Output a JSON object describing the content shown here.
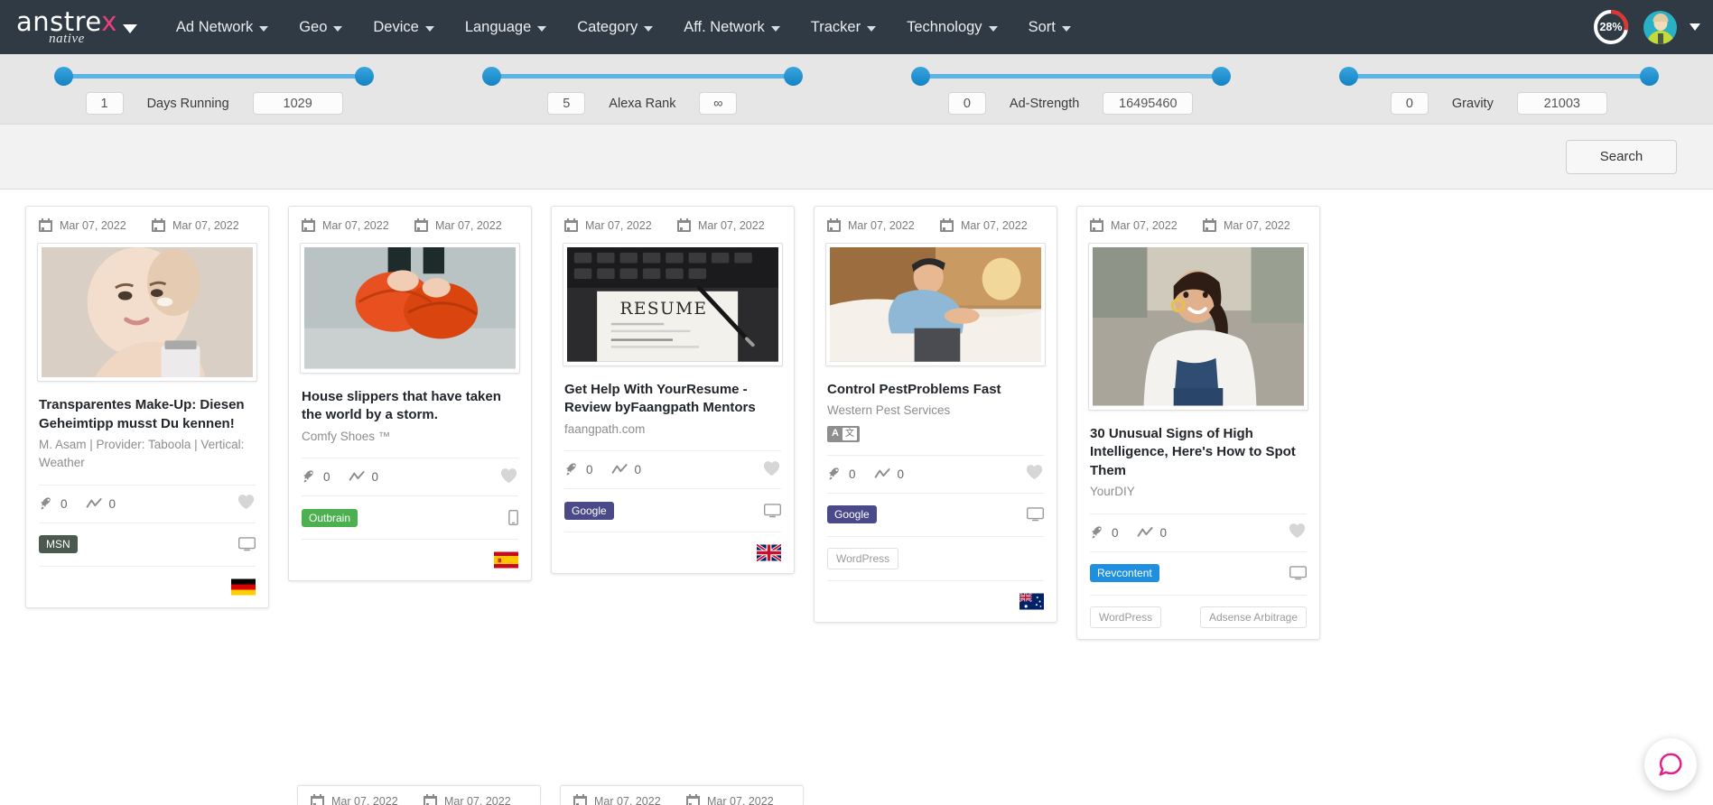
{
  "navbar": {
    "brand": {
      "main_pre": "anstre",
      "main_x": "x",
      "sub": "native"
    },
    "items": [
      {
        "label": "Ad Network"
      },
      {
        "label": "Geo"
      },
      {
        "label": "Device"
      },
      {
        "label": "Language"
      },
      {
        "label": "Category"
      },
      {
        "label": "Aff. Network"
      },
      {
        "label": "Tracker"
      },
      {
        "label": "Technology"
      },
      {
        "label": "Sort"
      }
    ],
    "progress": {
      "value": "28%",
      "percent": 28,
      "arc_color": "#e63329",
      "ring_color": "#ffffff"
    },
    "bg_color": "#2f3a45"
  },
  "filters": [
    {
      "name": "days-running",
      "label": "Days Running",
      "min": "1",
      "max": "1029",
      "fill_start_pct": 0,
      "fill_end_pct": 100
    },
    {
      "name": "alexa-rank",
      "label": "Alexa Rank",
      "min": "5",
      "max": "∞",
      "fill_start_pct": 0,
      "fill_end_pct": 100
    },
    {
      "name": "ad-strength",
      "label": "Ad-Strength",
      "min": "0",
      "max": "16495460",
      "fill_start_pct": 0,
      "fill_end_pct": 100
    },
    {
      "name": "gravity",
      "label": "Gravity",
      "min": "0",
      "max": "21003",
      "fill_start_pct": 0,
      "fill_end_pct": 100
    }
  ],
  "search": {
    "label": "Search"
  },
  "cards": [
    {
      "date_start": "Mar 07, 2022",
      "date_end": "Mar 07, 2022",
      "title": "Transparentes Make-Up: Diesen Geheimtipp musst Du kennen!",
      "subtitle": "M. Asam | Provider: Taboola | Vertical: Weather",
      "has_translate_badge": false,
      "stat_rocket": "0",
      "stat_trend": "0",
      "network_badge": "MSN",
      "network_badge_class": "badge-msn",
      "platform_icon": "desktop-icon",
      "cms_badge": null,
      "flag": "de",
      "thumb_alt": "woman-applying-face-cream"
    },
    {
      "date_start": "Mar 07, 2022",
      "date_end": "Mar 07, 2022",
      "title": "House slippers that have taken the world by a storm.",
      "subtitle": "Comfy Shoes ™",
      "has_translate_badge": false,
      "stat_rocket": "0",
      "stat_trend": "0",
      "network_badge": "Outbrain",
      "network_badge_class": "badge-outbrain",
      "platform_icon": "mobile-icon",
      "cms_badge": null,
      "flag": "es",
      "thumb_alt": "orange-house-slippers"
    },
    {
      "date_start": "Mar 07, 2022",
      "date_end": "Mar 07, 2022",
      "title": "Get Help With YourResume - Review byFaangpath Mentors",
      "subtitle": "faangpath.com",
      "has_translate_badge": false,
      "stat_rocket": "0",
      "stat_trend": "0",
      "network_badge": "Google",
      "network_badge_class": "badge-google",
      "platform_icon": "desktop-icon",
      "cms_badge": null,
      "flag": "gb",
      "thumb_alt": "resume-document-with-pen-and-keyboard"
    },
    {
      "date_start": "Mar 07, 2022",
      "date_end": "Mar 07, 2022",
      "title": "Control PestProblems Fast",
      "subtitle": "Western Pest Services",
      "has_translate_badge": true,
      "stat_rocket": "0",
      "stat_trend": "0",
      "network_badge": "Google",
      "network_badge_class": "badge-google",
      "platform_icon": "desktop-icon",
      "cms_badge": "WordPress",
      "flag": "au",
      "thumb_alt": "pest-control-technician-working"
    },
    {
      "date_start": "Mar 07, 2022",
      "date_end": "Mar 07, 2022",
      "title": "30 Unusual Signs of High Intelligence, Here's How to Spot Them",
      "subtitle": "YourDIY",
      "has_translate_badge": false,
      "stat_rocket": "0",
      "stat_trend": "0",
      "network_badge": "Revcontent",
      "network_badge_class": "badge-revcontent",
      "platform_icon": "desktop-icon",
      "cms_badge": "WordPress",
      "cms_badge2": "Adsense Arbitrage",
      "flag": null,
      "thumb_alt": "smiling-woman-with-braid-outdoors"
    }
  ],
  "peek_cards": [
    {
      "date_start": "Mar 07, 2022",
      "date_end": "Mar 07, 2022"
    },
    {
      "date_start": "Mar 07, 2022",
      "date_end": "Mar 07, 2022"
    }
  ],
  "chat": {
    "icon": "chat-bubble-icon",
    "color": "#e0218a"
  }
}
